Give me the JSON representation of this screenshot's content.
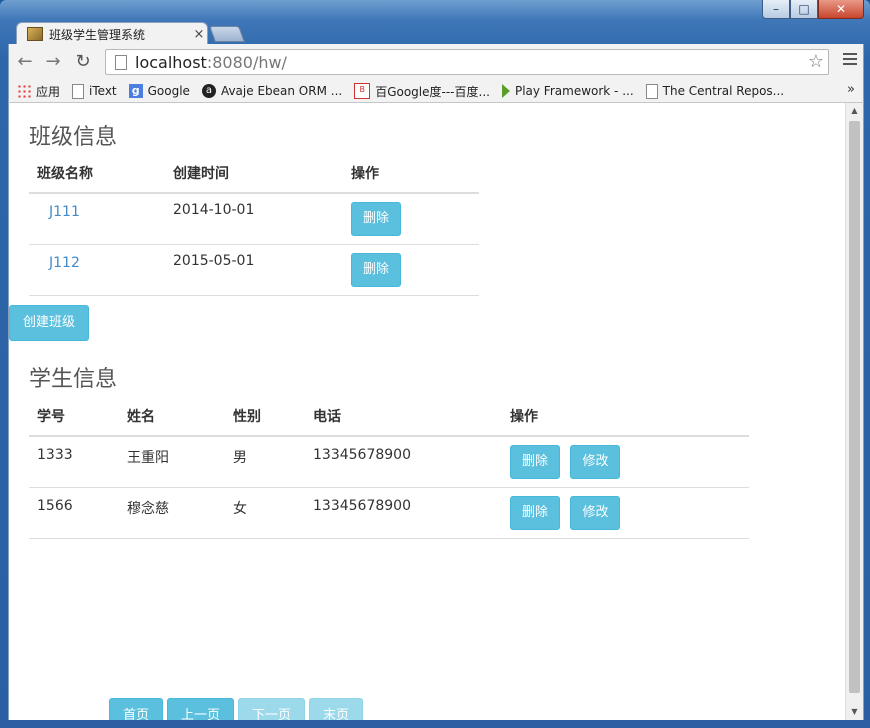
{
  "browser": {
    "tab_title": "班级学生管理系统",
    "tab_close": "×",
    "url_host": "localhost",
    "url_path": ":8080/hw/",
    "window_controls": {
      "minimize": "–",
      "maximize": "□",
      "close": "✕"
    },
    "nav": {
      "back": "←",
      "forward": "→",
      "reload": "↻"
    },
    "bookmark_star": "☆",
    "bookmarks": [
      {
        "label": "应用",
        "icon": "apps-icon"
      },
      {
        "label": "iText",
        "icon": "page-icon"
      },
      {
        "label": "Google",
        "icon": "google-icon"
      },
      {
        "label": "Avaje Ebean ORM ...",
        "icon": "avaje-icon"
      },
      {
        "label": "百Google度---百度...",
        "icon": "baidu-icon"
      },
      {
        "label": "Play Framework - ...",
        "icon": "play-icon"
      },
      {
        "label": "The Central Repos...",
        "icon": "page-icon"
      }
    ],
    "bookmarks_more": "»"
  },
  "classes": {
    "heading": "班级信息",
    "columns": [
      "班级名称",
      "创建时间",
      "操作"
    ],
    "rows": [
      {
        "name": "J111",
        "created": "2014-10-01",
        "action": "删除"
      },
      {
        "name": "J112",
        "created": "2015-05-01",
        "action": "删除"
      }
    ],
    "create_button": "创建班级"
  },
  "students": {
    "heading": "学生信息",
    "columns": [
      "学号",
      "姓名",
      "性别",
      "电话",
      "操作"
    ],
    "rows": [
      {
        "id": "1333",
        "name": "王重阳",
        "gender": "男",
        "phone": "13345678900",
        "delete": "删除",
        "edit": "修改"
      },
      {
        "id": "1566",
        "name": "穆念慈",
        "gender": "女",
        "phone": "13345678900",
        "delete": "删除",
        "edit": "修改"
      }
    ]
  },
  "pager": {
    "first": "首页",
    "prev": "上一页",
    "next": "下一页",
    "last": "末页"
  },
  "colors": {
    "accent": "#5bc0de",
    "link": "#428bca"
  }
}
